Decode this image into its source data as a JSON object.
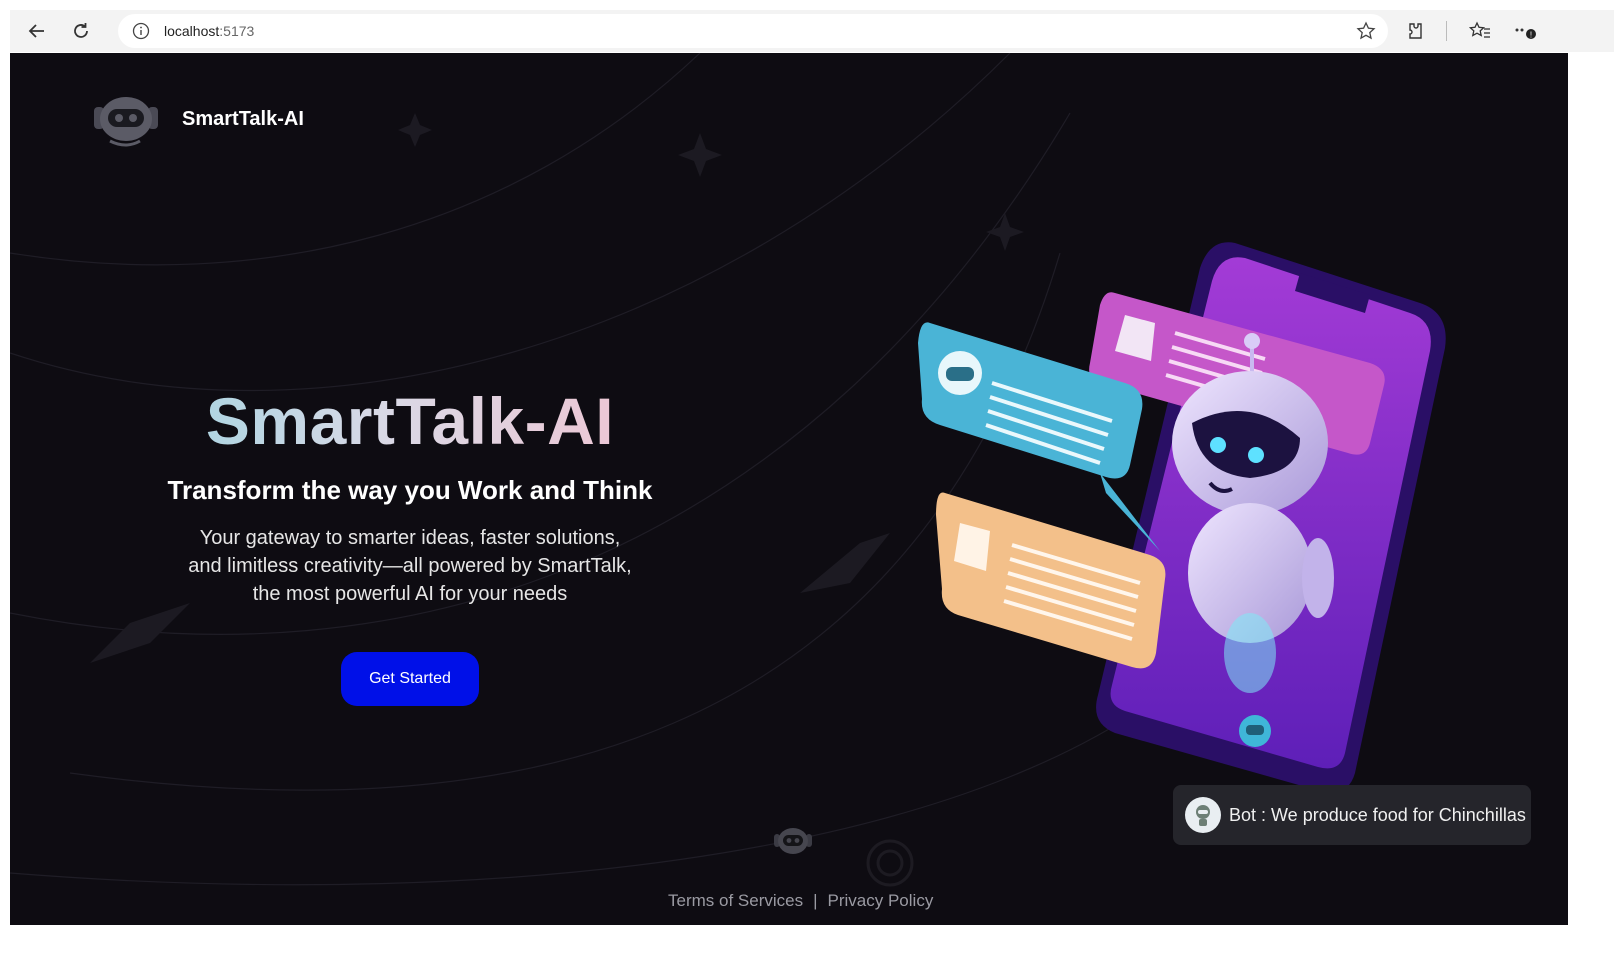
{
  "browser": {
    "url_host": "localhost",
    "url_port": ":5173"
  },
  "brand": {
    "name": "SmartTalk-AI"
  },
  "hero": {
    "title": "SmartTalk-AI",
    "subtitle": "Transform the way you Work and Think",
    "description_lines": [
      "Your gateway to smarter ideas, faster solutions,",
      "and limitless creativity—all powered by SmartTalk,",
      "the most powerful AI for your needs"
    ],
    "cta_label": "Get Started"
  },
  "bot_toast": {
    "message": "Bot : We produce food for Chinchillas"
  },
  "footer": {
    "terms": "Terms of Services",
    "separator": "|",
    "privacy": "Privacy Policy"
  },
  "colors": {
    "background": "#0e0c12",
    "cta": "#0010e8",
    "toast_bg": "#25252b"
  },
  "icons": [
    "back-icon",
    "reload-icon",
    "info-icon",
    "star-icon",
    "extensions-icon",
    "favorites-icon",
    "more-icon",
    "robot-logo-icon"
  ]
}
